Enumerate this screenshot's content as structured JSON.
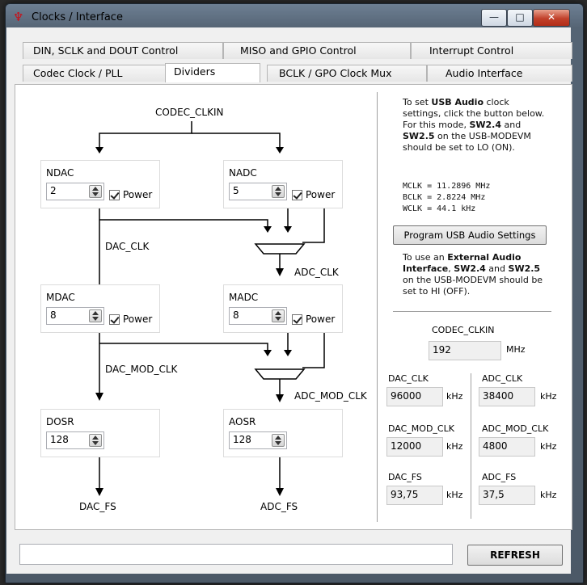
{
  "window": {
    "title": "Clocks / Interface"
  },
  "tabs": {
    "row1": [
      "DIN, SCLK and DOUT Control",
      "MISO and GPIO Control",
      "Interrupt Control"
    ],
    "row2": [
      "Codec Clock / PLL",
      "Dividers",
      "BCLK / GPO Clock Mux",
      "Audio Interface"
    ],
    "active": "Dividers"
  },
  "diagram": {
    "codec_clkin": "CODEC_CLKIN",
    "ndac": {
      "label": "NDAC",
      "value": "2",
      "power": "Power"
    },
    "nadc": {
      "label": "NADC",
      "value": "5",
      "power": "Power"
    },
    "dac_clk": "DAC_CLK",
    "adc_clk": "ADC_CLK",
    "mdac": {
      "label": "MDAC",
      "value": "8",
      "power": "Power"
    },
    "madc": {
      "label": "MADC",
      "value": "8",
      "power": "Power"
    },
    "dac_mod_clk": "DAC_MOD_CLK",
    "adc_mod_clk": "ADC_MOD_CLK",
    "dosr": {
      "label": "DOSR",
      "value": "128"
    },
    "aosr": {
      "label": "AOSR",
      "value": "128"
    },
    "dac_fs": "DAC_FS",
    "adc_fs": "ADC_FS"
  },
  "sidebar": {
    "usb_info_1": "To set ",
    "usb_info_bold1": "USB Audio",
    "usb_info_2": " clock settings, click the button below. For this mode, ",
    "usb_info_bold2": "SW2.4",
    "usb_info_3": " and ",
    "usb_info_bold3": "SW2.5",
    "usb_info_4": " on the USB-MODEVM should be set to LO (ON).",
    "mclk": "MCLK = 11.2896 MHz",
    "bclk": "BCLK = 2.8224 MHz",
    "wclk": "WCLK = 44.1 kHz",
    "program_button": "Program USB Audio Settings",
    "ext_info_1": "To use an ",
    "ext_info_bold1": "External Audio Interface",
    "ext_info_2": ", ",
    "ext_info_bold2": "SW2.4",
    "ext_info_3": " and ",
    "ext_info_bold3": "SW2.5",
    "ext_info_4": " on the USB-MODEVM should be set to HI (OFF).",
    "codec_clkin_label": "CODEC_CLKIN",
    "codec_clkin_value": "192",
    "codec_clkin_unit": "MHz",
    "dac_clk_label": "DAC_CLK",
    "dac_clk_value": "96000",
    "adc_clk_label": "ADC_CLK",
    "adc_clk_value": "38400",
    "dac_mod_clk_label": "DAC_MOD_CLK",
    "dac_mod_clk_value": "12000",
    "adc_mod_clk_label": "ADC_MOD_CLK",
    "adc_mod_clk_value": "4800",
    "dac_fs_label": "DAC_FS",
    "dac_fs_value": "93,75",
    "adc_fs_label": "ADC_FS",
    "adc_fs_value": "37,5",
    "khz": "kHz"
  },
  "footer": {
    "status_text": "",
    "refresh_label": "REFRESH"
  }
}
